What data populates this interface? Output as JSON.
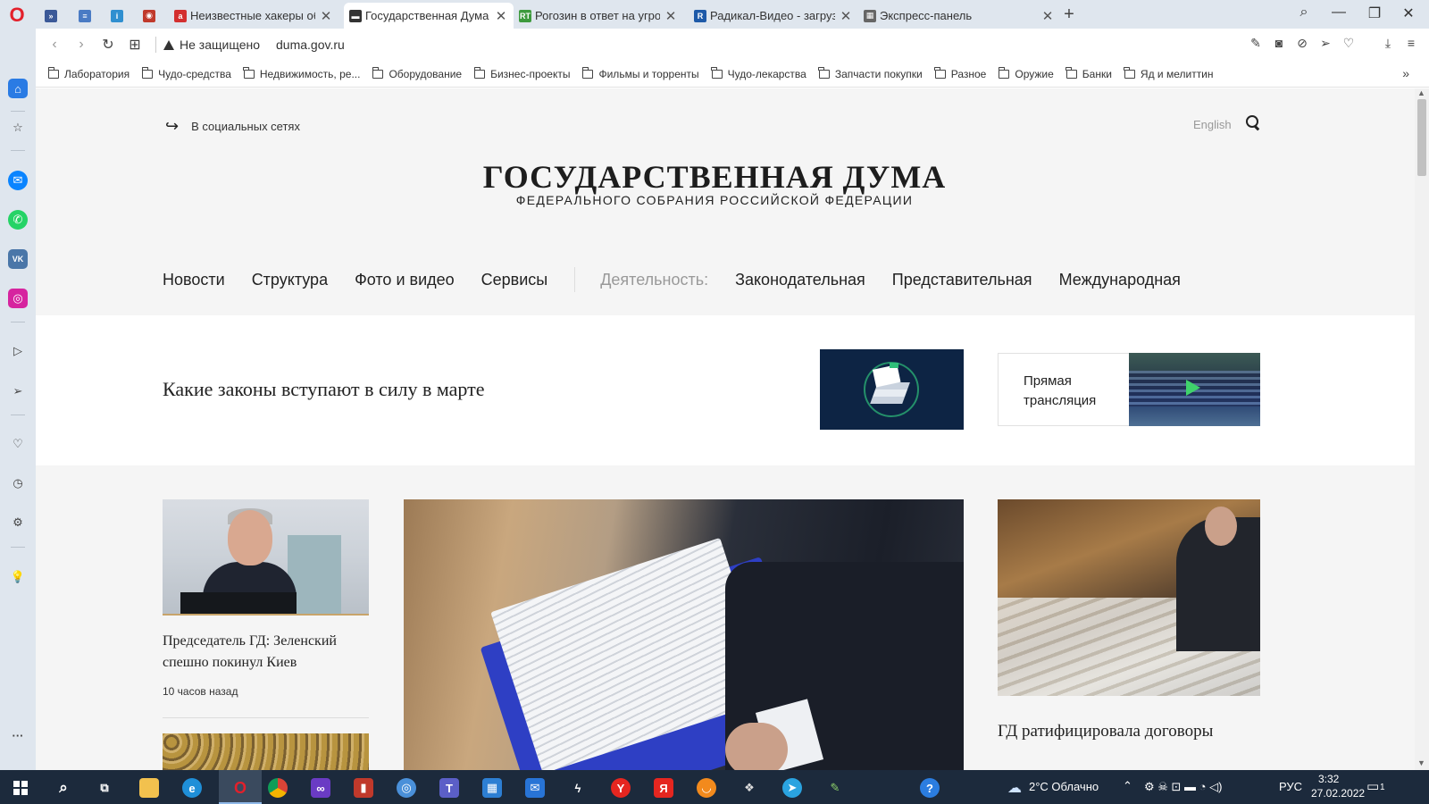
{
  "browser": {
    "tabs": [
      {
        "title": "",
        "color": "#3b5998",
        "glyph": "»",
        "pinned": true
      },
      {
        "title": "",
        "color": "#4a7bc4",
        "glyph": "≡",
        "pinned": true
      },
      {
        "title": "",
        "color": "#2f8fd0",
        "glyph": "i",
        "pinned": true
      },
      {
        "title": "",
        "color": "#c0392b",
        "glyph": "◉",
        "pinned": true
      },
      {
        "title": "Неизвестные хакеры обру",
        "color": "#d32f2f",
        "glyph": "a",
        "pinned": false
      },
      {
        "title": "Государственная Дума",
        "color": "#333333",
        "glyph": "▬",
        "pinned": false,
        "active": true
      },
      {
        "title": "Рогозин в ответ на угрозы",
        "color": "#3d9a3d",
        "glyph": "RT",
        "pinned": false
      },
      {
        "title": "Радикал-Видео - загрузка",
        "color": "#1e5aa8",
        "glyph": "R",
        "pinned": false
      },
      {
        "title": "Экспресс-панель",
        "color": "#666666",
        "glyph": "▦",
        "pinned": false
      }
    ],
    "security_label": "Не защищено",
    "url": "duma.gov.ru",
    "bookmarks": [
      "Лаборатория",
      "Чудо-средства",
      "Недвижимость, ре...",
      "Оборудование",
      "Бизнес-проекты",
      "Фильмы и торренты",
      "Чудо-лекарства",
      "Запчасти покупки",
      "Разное",
      "Оружие",
      "Банки",
      "Яд и мелиттин"
    ]
  },
  "site": {
    "social_label": "В социальных сетях",
    "lang_label": "English",
    "title": "ГОСУДАРСТВЕННАЯ ДУМА",
    "subtitle": "ФЕДЕРАЛЬНОГО СОБРАНИЯ РОССИЙСКОЙ ФЕДЕРАЦИИ",
    "nav": {
      "news": "Новости",
      "structure": "Структура",
      "media": "Фото и видео",
      "services": "Сервисы",
      "activity": "Деятельность:",
      "legislative": "Законодательная",
      "representative": "Представительная",
      "international": "Международная"
    },
    "banner_text": "Какие законы вступают в силу в марте",
    "live_label": "Прямая трансляция",
    "card1": {
      "title": "Председатель ГД: Зеленский спешно покинул Киев",
      "time": "10 часов назад"
    },
    "card3": {
      "title": "ГД ратифицировала договоры"
    }
  },
  "taskbar": {
    "weather": "2°C  Облачно",
    "lang": "РУС",
    "time": "3:32",
    "date": "27.02.2022",
    "notif_count": "1"
  }
}
